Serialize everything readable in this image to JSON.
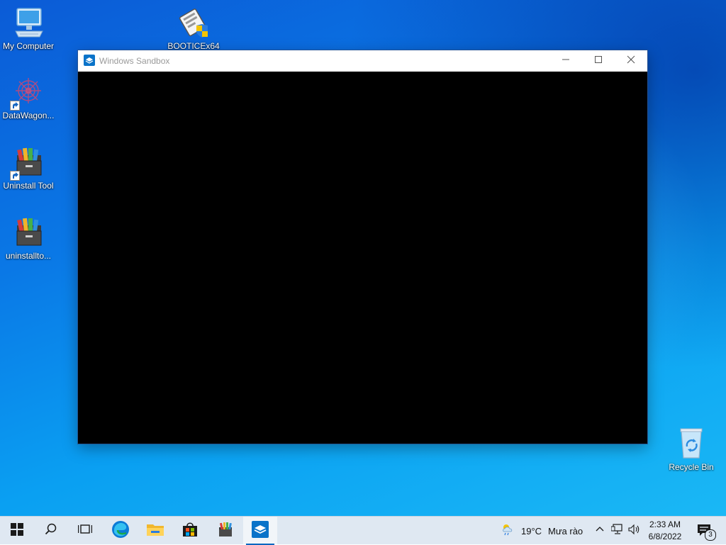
{
  "desktop": {
    "icons": [
      {
        "label": "My Computer"
      },
      {
        "label": "BOOTICEx64"
      },
      {
        "label": "DataWagon..."
      },
      {
        "label": "Uninstall Tool"
      },
      {
        "label": "uninstallto..."
      },
      {
        "label": "Recycle Bin"
      }
    ]
  },
  "window": {
    "title": "Windows Sandbox",
    "controls": {
      "minimize": "minimize-icon",
      "maximize": "maximize-icon",
      "close": "close-icon"
    }
  },
  "taskbar": {
    "pinned": [
      {
        "icon": "windows-start-icon"
      },
      {
        "icon": "search-icon"
      },
      {
        "icon": "task-view-icon"
      },
      {
        "icon": "edge-icon"
      },
      {
        "icon": "file-explorer-icon"
      },
      {
        "icon": "microsoft-store-icon"
      },
      {
        "icon": "uninstall-tool-icon"
      },
      {
        "icon": "windows-sandbox-icon",
        "active": true
      }
    ],
    "weather": {
      "temp": "19°C",
      "desc": "Mưa rào"
    },
    "clock": {
      "time": "2:33 AM",
      "date": "6/8/2022"
    },
    "notifications": {
      "count": "3"
    }
  },
  "colors": {
    "accent": "#0067c0",
    "taskbar_bg": "#dfe8f2",
    "window_client": "#000000",
    "title_text": "#9a9a9a"
  }
}
